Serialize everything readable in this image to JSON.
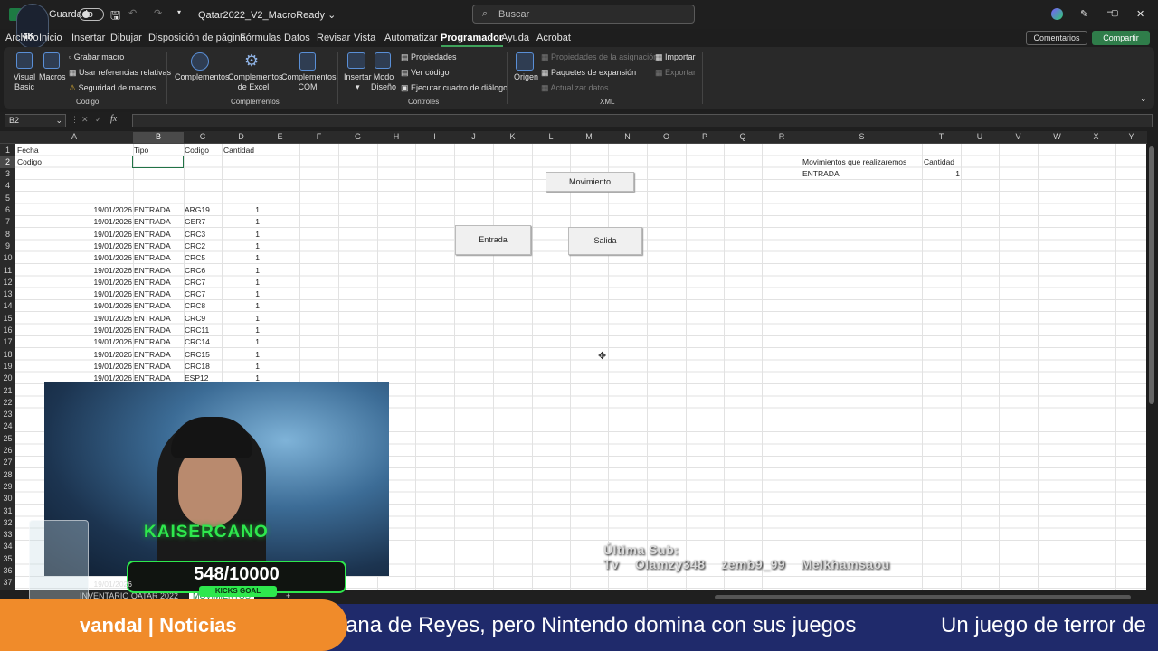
{
  "titlebar": {
    "autosave": "Guardado",
    "filename": "Qatar2022_V2_MacroReady",
    "search_placeholder": "Buscar"
  },
  "menu": [
    "Archivo",
    "Inicio",
    "Insertar",
    "Dibujar",
    "Disposición de página",
    "Fórmulas",
    "Datos",
    "Revisar",
    "Vista",
    "Automatizar",
    "Programador",
    "Ayuda",
    "Acrobat"
  ],
  "menu_active": "Programador",
  "actions": {
    "comments": "Comentarios",
    "share": "Compartir"
  },
  "ribbon": {
    "codigo": {
      "visual_basic": "Visual Basic",
      "macros": "Macros",
      "record": "Grabar macro",
      "relative": "Usar referencias relativas",
      "security": "Seguridad de macros",
      "group": "Código"
    },
    "complementos": {
      "addins": "Complementos",
      "excel_addins": "Complementos de Excel",
      "com_addins": "Complementos COM",
      "group": "Complementos"
    },
    "controles": {
      "insert": "Insertar",
      "design": "Modo Diseño",
      "properties": "Propiedades",
      "view_code": "Ver código",
      "dialog": "Ejecutar cuadro de diálogo",
      "group": "Controles"
    },
    "xml": {
      "source": "Origen",
      "map_props": "Propiedades de la asignación",
      "packs": "Paquetes de expansión",
      "refresh": "Actualizar datos",
      "import": "Importar",
      "export": "Exportar",
      "group": "XML"
    }
  },
  "namebox": "B2",
  "columns": [
    "A",
    "B",
    "C",
    "D",
    "E",
    "F",
    "G",
    "H",
    "I",
    "J",
    "K",
    "L",
    "M",
    "N",
    "O",
    "P",
    "Q",
    "R",
    "S",
    "T",
    "U",
    "V",
    "W",
    "X",
    "Y"
  ],
  "selected_column": "B",
  "rows": [
    "1",
    "2",
    "3",
    "4",
    "5",
    "6",
    "7",
    "8",
    "9",
    "10",
    "11",
    "12",
    "13",
    "14",
    "15",
    "16",
    "17",
    "18",
    "19",
    "20",
    "21",
    "22",
    "23",
    "24",
    "25",
    "26",
    "27",
    "28",
    "29",
    "30",
    "31",
    "32",
    "33",
    "34",
    "35",
    "36",
    "37"
  ],
  "sheet": {
    "headers": {
      "a1": "Fecha",
      "b1": "Tipo",
      "c1": "Codigo",
      "d1": "Cantidad",
      "a2": "Codigo"
    },
    "records": [
      {
        "fecha": "19/01/2026",
        "tipo": "ENTRADA",
        "codigo": "ARG19",
        "cantidad": "1"
      },
      {
        "fecha": "19/01/2026",
        "tipo": "ENTRADA",
        "codigo": "GER7",
        "cantidad": "1"
      },
      {
        "fecha": "19/01/2026",
        "tipo": "ENTRADA",
        "codigo": "CRC3",
        "cantidad": "1"
      },
      {
        "fecha": "19/01/2026",
        "tipo": "ENTRADA",
        "codigo": "CRC2",
        "cantidad": "1"
      },
      {
        "fecha": "19/01/2026",
        "tipo": "ENTRADA",
        "codigo": "CRC5",
        "cantidad": "1"
      },
      {
        "fecha": "19/01/2026",
        "tipo": "ENTRADA",
        "codigo": "CRC6",
        "cantidad": "1"
      },
      {
        "fecha": "19/01/2026",
        "tipo": "ENTRADA",
        "codigo": "CRC7",
        "cantidad": "1"
      },
      {
        "fecha": "19/01/2026",
        "tipo": "ENTRADA",
        "codigo": "CRC7",
        "cantidad": "1"
      },
      {
        "fecha": "19/01/2026",
        "tipo": "ENTRADA",
        "codigo": "CRC8",
        "cantidad": "1"
      },
      {
        "fecha": "19/01/2026",
        "tipo": "ENTRADA",
        "codigo": "CRC9",
        "cantidad": "1"
      },
      {
        "fecha": "19/01/2026",
        "tipo": "ENTRADA",
        "codigo": "CRC11",
        "cantidad": "1"
      },
      {
        "fecha": "19/01/2026",
        "tipo": "ENTRADA",
        "codigo": "CRC14",
        "cantidad": "1"
      },
      {
        "fecha": "19/01/2026",
        "tipo": "ENTRADA",
        "codigo": "CRC15",
        "cantidad": "1"
      },
      {
        "fecha": "19/01/2026",
        "tipo": "ENTRADA",
        "codigo": "CRC18",
        "cantidad": "1"
      },
      {
        "fecha": "19/01/2026",
        "tipo": "ENTRADA",
        "codigo": "ESP12",
        "cantidad": "1"
      }
    ],
    "row37_date": "19/01/2026",
    "side": {
      "label": "Movimientos que realizaremos",
      "qty_header": "Cantidad",
      "type": "ENTRADA",
      "qty": "1"
    }
  },
  "buttons": {
    "movimiento": "Movimiento",
    "entrada": "Entrada",
    "salida": "Salida"
  },
  "tabs": [
    "INVENTARIO QATAR 2022",
    "MOVIMIENTOS"
  ],
  "overlay": {
    "streamer": "KAISERCANO",
    "goal_count": "548/10000",
    "goal_label": "KICKS GOAL",
    "subs_title": "Última Sub:",
    "subs": "Tv    Olamzy348    zemb9_99    Melkhamsaou",
    "brand": "vandal | Noticias",
    "headline1": "ana de Reyes, pero Nintendo domina con sus juegos",
    "headline2": "Un juego de terror de"
  }
}
